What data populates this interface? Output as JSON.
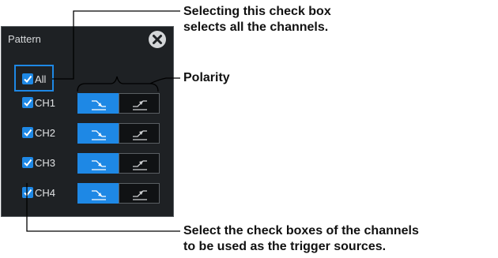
{
  "dialog": {
    "title": "Pattern",
    "all_label": "All",
    "channels": [
      "CH1",
      "CH2",
      "CH3",
      "CH4"
    ],
    "polarity_icons": [
      "falling-edge-icon",
      "rising-edge-icon"
    ],
    "selected_polarity": "falling"
  },
  "callouts": {
    "select_all_line1": "Selecting this check box",
    "select_all_line2": "selects all the channels.",
    "polarity": "Polarity",
    "trigger_line1": "Select the check boxes of the channels",
    "trigger_line2": "to be used as the trigger sources."
  },
  "colors": {
    "accent": "#1e88e5",
    "panel": "#1e2124",
    "border": "#5a5f63"
  }
}
